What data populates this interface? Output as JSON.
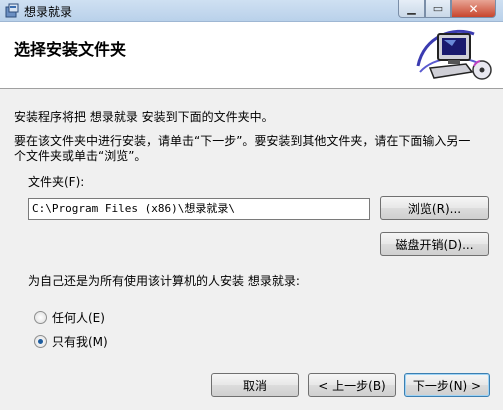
{
  "window": {
    "title": "想录就录",
    "minimize_symbol": "▁",
    "maximize_symbol": "▭",
    "close_symbol": "✕"
  },
  "header": {
    "title": "选择安装文件夹"
  },
  "body": {
    "line1": "安装程序将把 想录就录 安装到下面的文件夹中。",
    "line2": "要在该文件夹中进行安装，请单击“下一步”。要安装到其他文件夹，请在下面输入另一",
    "line3": "个文件夹或单击“浏览”。",
    "folder_label": "文件夹(F):",
    "folder_value": "C:\\Program Files (x86)\\想录就录\\",
    "browse_label": "浏览(R)...",
    "disk_cost_label": "磁盘开销(D)...",
    "install_for_question": "为自己还是为所有使用该计算机的人安装 想录就录:",
    "radio_everyone": "任何人(E)",
    "radio_just_me": "只有我(M)",
    "selected_option": "just_me"
  },
  "footer": {
    "cancel_label": "取消",
    "back_label": "< 上一步(B)",
    "next_label": "下一步(N) >"
  },
  "icons": {
    "app": "setup-icon",
    "banner": "computer-install-icon"
  }
}
